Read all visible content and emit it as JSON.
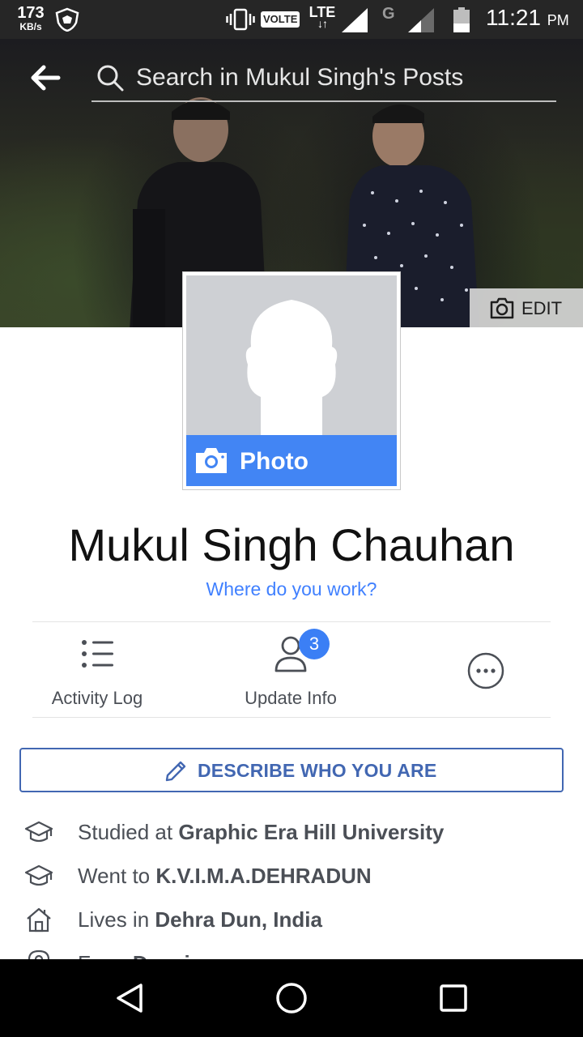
{
  "status_bar": {
    "net_speed_value": "173",
    "net_speed_unit": "KB/s",
    "volte_label": "VOLTE",
    "lte_label": "LTE",
    "network_g_label": "G",
    "time": "11:21",
    "ampm": "PM"
  },
  "header": {
    "search_placeholder": "Search in Mukul Singh's Posts",
    "edit_cover_label": "EDIT"
  },
  "profile": {
    "photo_label": "Photo",
    "name": "Mukul Singh Chauhan",
    "work_prompt": "Where do you work?"
  },
  "actions": {
    "activity_log_label": "Activity Log",
    "update_info_label": "Update Info",
    "update_info_badge": "3"
  },
  "describe_button_label": "DESCRIBE WHO YOU ARE",
  "intro": [
    {
      "icon": "graduation-cap-icon",
      "prefix": "Studied at ",
      "value": "Graphic Era Hill University"
    },
    {
      "icon": "graduation-cap-icon",
      "prefix": "Went to ",
      "value": "K.V.I.M.A.DEHRADUN"
    },
    {
      "icon": "home-icon",
      "prefix": "Lives in ",
      "value": "Dehra Dun, India"
    },
    {
      "icon": "location-pin-icon",
      "prefix": "From ",
      "value": "Dewri"
    }
  ],
  "colors": {
    "facebook_blue": "#4267b2",
    "link_blue": "#4080ff",
    "photo_bar_blue": "#4285f4",
    "badge_blue": "#3b7ff5",
    "status_bar": "#262626"
  }
}
